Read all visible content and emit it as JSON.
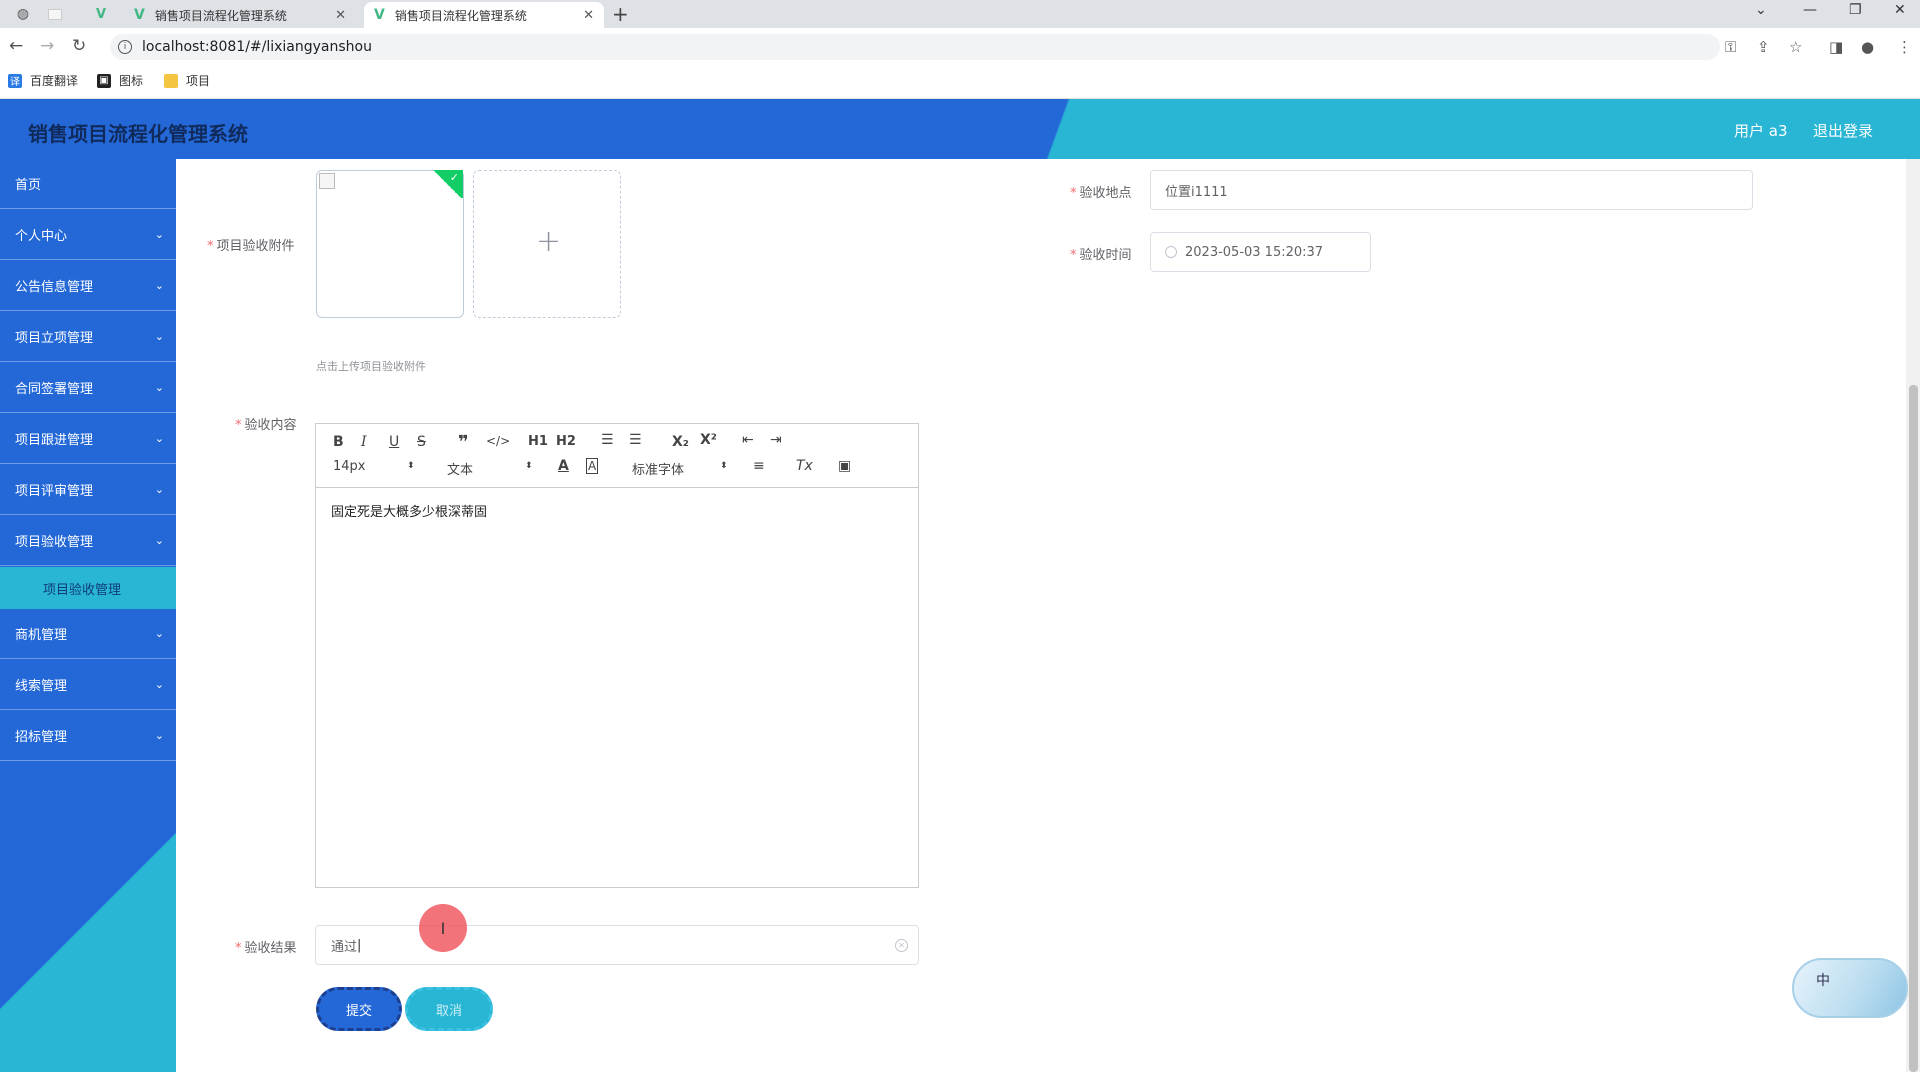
{
  "browser": {
    "tabs": [
      {
        "title": "销售项目流程化管理系统",
        "active": false
      },
      {
        "title": "销售项目流程化管理系统",
        "active": true
      }
    ],
    "url": "localhost:8081/#/lixiangyanshou",
    "bookmarks": [
      "百度翻译",
      "图标",
      "项目"
    ]
  },
  "header": {
    "title": "销售项目流程化管理系统",
    "user": "用户 a3",
    "logout": "退出登录"
  },
  "sidebar": {
    "items": [
      {
        "label": "首页",
        "has_children": false
      },
      {
        "label": "个人中心",
        "has_children": true
      },
      {
        "label": "公告信息管理",
        "has_children": true
      },
      {
        "label": "项目立项管理",
        "has_children": true
      },
      {
        "label": "合同签署管理",
        "has_children": true
      },
      {
        "label": "项目跟进管理",
        "has_children": true
      },
      {
        "label": "项目评审管理",
        "has_children": true
      },
      {
        "label": "项目验收管理",
        "has_children": true
      },
      {
        "label": "商机管理",
        "has_children": true
      },
      {
        "label": "线索管理",
        "has_children": true
      },
      {
        "label": "招标管理",
        "has_children": true
      }
    ],
    "active_sub": "项目验收管理"
  },
  "form": {
    "attachment_label": "项目验收附件",
    "upload_tip": "点击上传项目验收附件",
    "location_label": "验收地点",
    "location_value": "位置i1111",
    "time_label": "验收时间",
    "time_value": "2023-05-03 15:20:37",
    "content_label": "验收内容",
    "content_value": "固定死是大概多少根深蒂固",
    "result_label": "验收结果",
    "result_value": "通过",
    "submit_label": "提交",
    "cancel_label": "取消"
  },
  "editor_toolbar": {
    "h1": "H1",
    "h2": "H2",
    "size": "14px",
    "format": "文本",
    "font": "标准字体"
  },
  "ime": {
    "label": "中"
  }
}
